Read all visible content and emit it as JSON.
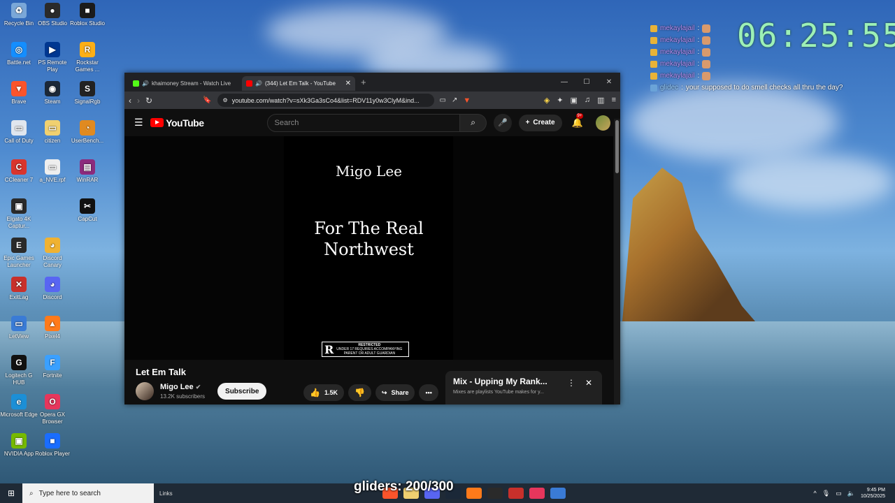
{
  "desktop": {
    "icons": [
      {
        "label": "Recycle Bin",
        "color": "#7aa7d8",
        "glyph": "♻"
      },
      {
        "label": "OBS Studio",
        "color": "#2a2a2a",
        "glyph": "●"
      },
      {
        "label": "Roblox Studio",
        "color": "#1b1b1b",
        "glyph": "■"
      },
      {
        "label": "Battle.net",
        "color": "#148eff",
        "glyph": "◎"
      },
      {
        "label": "PS Remote Play",
        "color": "#003791",
        "glyph": "▶"
      },
      {
        "label": "Rockstar Games ...",
        "color": "#fcaf17",
        "glyph": "R"
      },
      {
        "label": "Brave",
        "color": "#fb542b",
        "glyph": "▼"
      },
      {
        "label": "Steam",
        "color": "#1b2838",
        "glyph": "◉"
      },
      {
        "label": "SignalRgb",
        "color": "#222",
        "glyph": "S"
      },
      {
        "label": "Call of Duty",
        "color": "#e0e6ee",
        "glyph": "▭"
      },
      {
        "label": "citizen",
        "color": "#f0d070",
        "glyph": "▭"
      },
      {
        "label": "UserBench...",
        "color": "#e08a20",
        "glyph": "◔"
      },
      {
        "label": "CCleaner 7",
        "color": "#d9352d",
        "glyph": "C"
      },
      {
        "label": "a_NVE.rpf",
        "color": "#eeeeee",
        "glyph": "▭"
      },
      {
        "label": "WinRAR",
        "color": "#8c2b7d",
        "glyph": "▤"
      },
      {
        "label": "Elgato 4K Captur...",
        "color": "#2a2a2a",
        "glyph": "▣"
      },
      {
        "label": "CapCut",
        "color": "#111",
        "glyph": "✂"
      },
      {
        "label": "Epic Games Launcher",
        "color": "#2a2a2a",
        "glyph": "E"
      },
      {
        "label": "Discord Canary",
        "color": "#f0b232",
        "glyph": "◕"
      },
      {
        "label": "ExitLag",
        "color": "#c8302b",
        "glyph": "✕"
      },
      {
        "label": "Discord",
        "color": "#5865f2",
        "glyph": "◕"
      },
      {
        "label": "LetView",
        "color": "#3a7bd5",
        "glyph": "▭"
      },
      {
        "label": "Pixel4",
        "color": "#ff7a1a",
        "glyph": "▲"
      },
      {
        "label": "Logitech G HUB",
        "color": "#111",
        "glyph": "G"
      },
      {
        "label": "Fortnite",
        "color": "#3aa0ff",
        "glyph": "F"
      },
      {
        "label": "Microsoft Edge",
        "color": "#1c8fd6",
        "glyph": "e"
      },
      {
        "label": "Opera GX Browser",
        "color": "#e6365c",
        "glyph": "O"
      },
      {
        "label": "NVIDIA App",
        "color": "#76b900",
        "glyph": "▣"
      },
      {
        "label": "Roblox Player",
        "color": "#1a6dff",
        "glyph": "■"
      }
    ]
  },
  "chat": {
    "lines": [
      {
        "user": "mekaylajail",
        "message": ""
      },
      {
        "user": "mekaylajail",
        "message": ""
      },
      {
        "user": "mekaylajail",
        "message": ""
      },
      {
        "user": "mekaylajail",
        "message": ""
      },
      {
        "user": "mekaylajail",
        "message": ""
      },
      {
        "user": "glidec",
        "message": "your supposed to do smell checks all thru the day?"
      }
    ]
  },
  "clock": "06:25:55",
  "browser": {
    "tabs": [
      {
        "title": "khaimoney Stream - Watch Live",
        "favicon_color": "#53fc18",
        "active": false
      },
      {
        "title": "(344) Let Em Talk - YouTube",
        "favicon_color": "#ff0000",
        "active": true
      }
    ],
    "new_tab": "+",
    "url": "youtube.com/watch?v=sXk3Ga3sCo4&list=RDV11y0w3ClyM&ind..."
  },
  "youtube": {
    "logo": "YouTube",
    "search_placeholder": "Search",
    "create_label": "Create",
    "notif_badge": "9+",
    "video": {
      "artist_text": "Migo Lee",
      "line1": "For The Real",
      "line2": "Northwest",
      "rating_letter": "R",
      "rating_title": "RESTRICTED",
      "rating_line1": "UNDER 17 REQUIRES ACCOMPANYING",
      "rating_line2": "PARENT OR ADULT GUARDIAN"
    },
    "title": "Let Em Talk",
    "channel": "Migo Lee",
    "subscribers": "13.2K subscribers",
    "subscribe_label": "Subscribe",
    "likes": "1.5K",
    "share_label": "Share",
    "mix_title": "Mix - Upping My Rank...",
    "mix_subtitle": "Mixes are playlists YouTube makes for y..."
  },
  "taskbar": {
    "search_placeholder": "Type here to search",
    "links_label": "Links",
    "time": "9:45 PM",
    "date": "10/25/2025",
    "apps_colors": [
      "#fb542b",
      "#f0d070",
      "#5865f2",
      "#1b2838",
      "#ff7a1a",
      "#2a2a2a",
      "#c8302b",
      "#e6365c",
      "#3a7bd5"
    ]
  },
  "overlay": {
    "gliders": "gliders: 200/300"
  }
}
